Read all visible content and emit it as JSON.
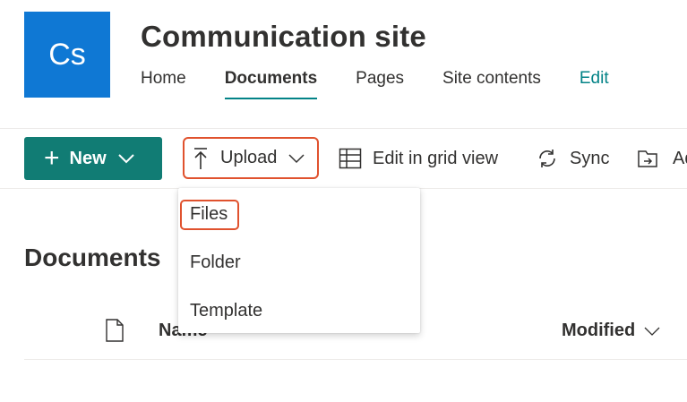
{
  "site": {
    "logo_initials": "Cs",
    "title": "Communication site",
    "nav": [
      {
        "label": "Home"
      },
      {
        "label": "Documents"
      },
      {
        "label": "Pages"
      },
      {
        "label": "Site contents"
      },
      {
        "label": "Edit"
      }
    ],
    "active_nav": "Documents",
    "brand_color": "#0f78d4",
    "accent_color": "#038387"
  },
  "commandbar": {
    "new_label": "New",
    "upload_label": "Upload",
    "grid_label": "Edit in grid view",
    "sync_label": "Sync",
    "add_label": "Ad"
  },
  "upload_menu": {
    "items": [
      {
        "label": "Files"
      },
      {
        "label": "Folder"
      },
      {
        "label": "Template"
      }
    ]
  },
  "library": {
    "heading": "Documents",
    "columns": {
      "name": "Name",
      "modified": "Modified"
    }
  },
  "highlight_color": "#e0522e"
}
